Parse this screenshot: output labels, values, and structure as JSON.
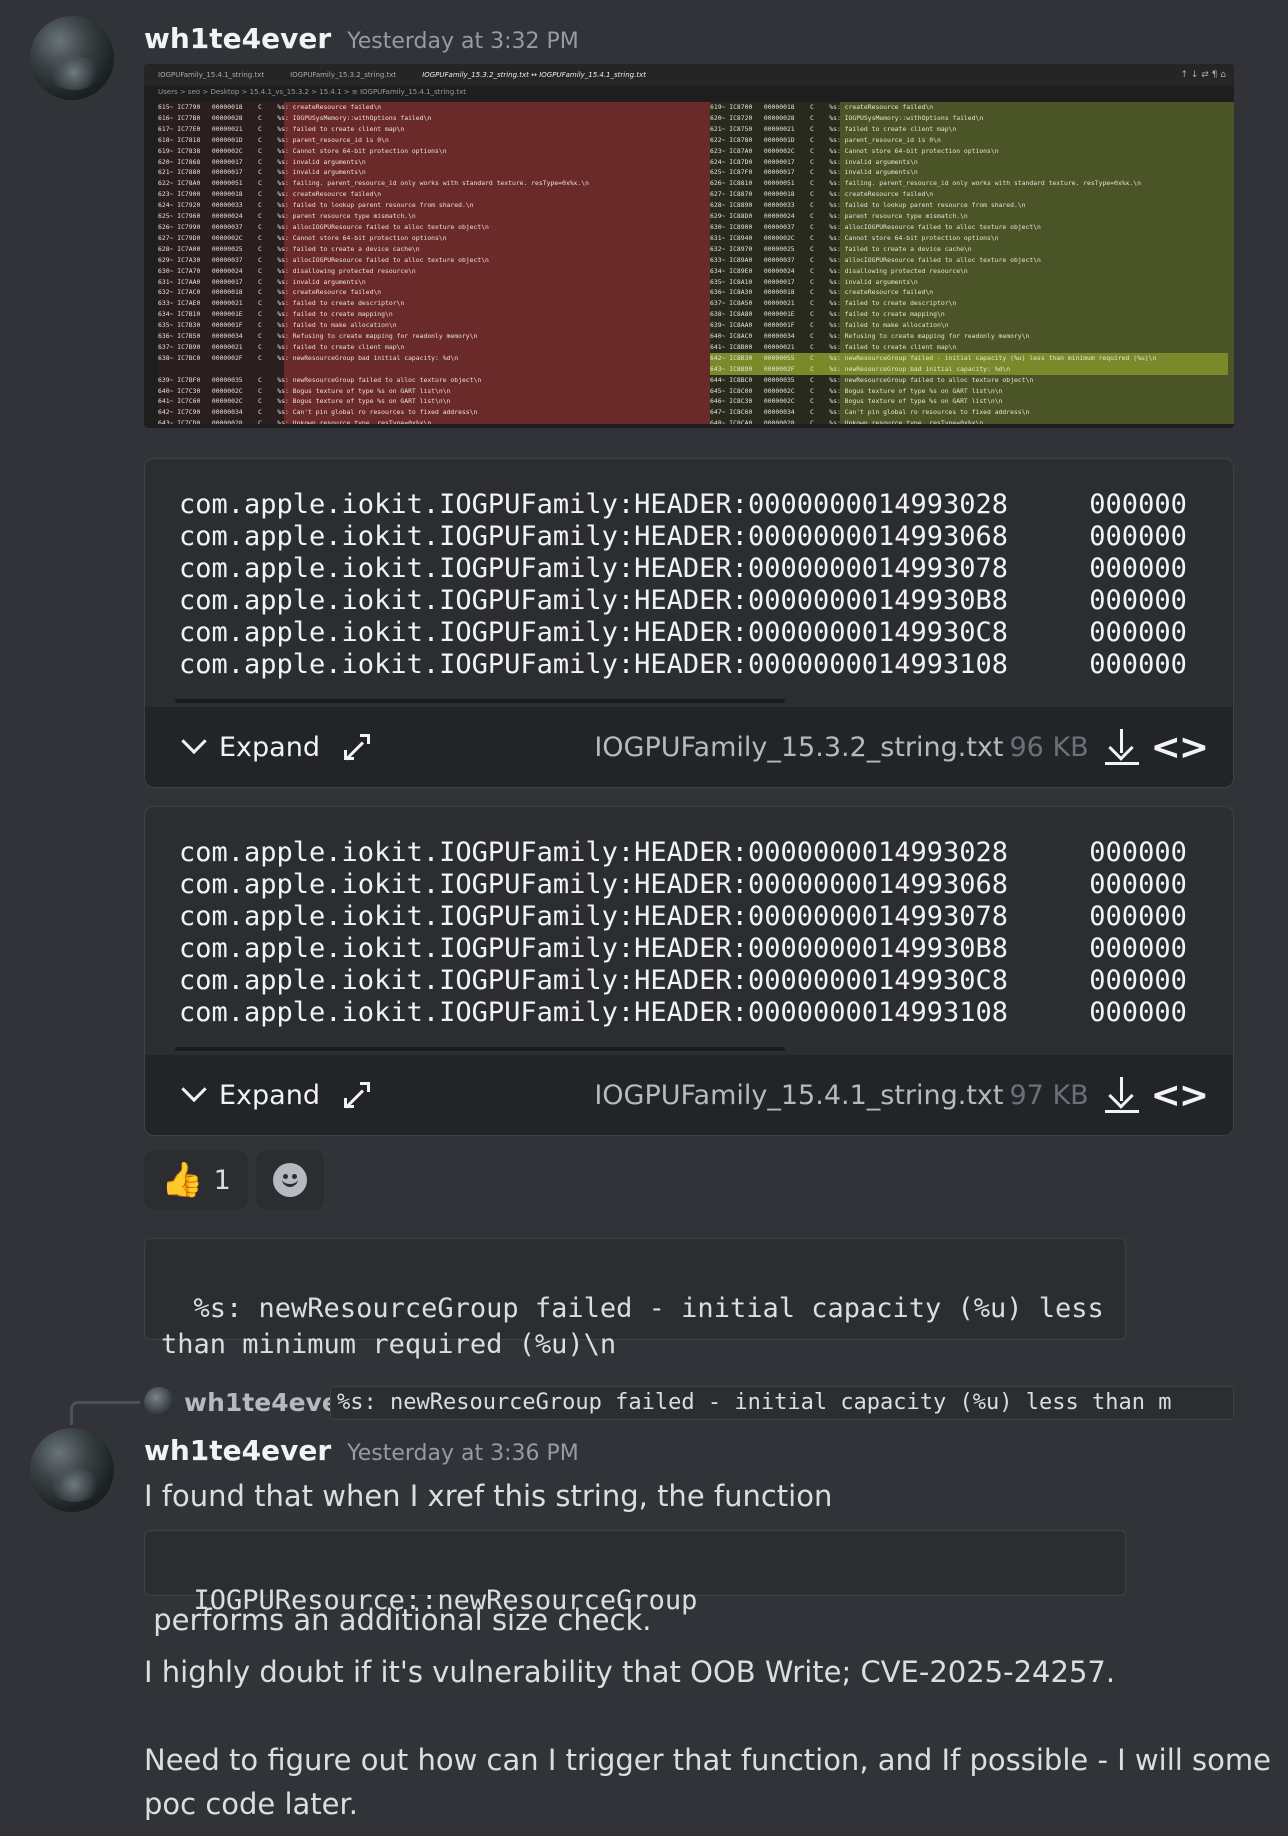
{
  "message1": {
    "username": "wh1te4ever",
    "timestamp": "Yesterday at 3:32 PM"
  },
  "screenshot": {
    "tabs": [
      "IOGPUFamily_15.4.1_string.txt",
      "IOGPUFamily_15.3.2_string.txt",
      "IOGPUFamily_15.3.2_string.txt ↔ IOGPUFamily_15.4.1_string.txt"
    ],
    "controls": "↑ ↓ ⇄ ¶ ⌂",
    "breadcrumb": "Users > seo > Desktop > 15.4.1_vs_15.3.2 > 15.4.1 > ≡ IOGPUFamily_15.4.1_string.txt",
    "left_lines": [
      "615~ IC7790   00000018    C    %s: createResource failed\\n",
      "616~ IC77B0   00000028    C    %s: IOGPUSysMemory::withOptions failed\\n",
      "617~ IC77E0   00000021    C    %s: failed to create client map\\n",
      "618~ IC7818   0000001D    C    %s: parent_resource_id is 0\\n",
      "619~ IC7838   0000002C    C    %s: Cannot store 64-bit protection options\\n",
      "620~ IC7868   00000017    C    %s: invalid arguments\\n",
      "621~ IC7880   00000017    C    %s: invalid arguments\\n",
      "622~ IC78A0   00000051    C    %s: failing. parent_resource_id only works with standard texture. resType=0x%x.\\n",
      "623~ IC7900   00000018    C    %s: createResource failed\\n",
      "624~ IC7920   00000033    C    %s: failed to lookup parent resource from shared.\\n",
      "625~ IC7960   00000024    C    %s: parent resource type mismatch.\\n",
      "626~ IC7990   00000037    C    %s: allocIOGPUResource failed to alloc texture object\\n",
      "627~ IC79D0   0000002C    C    %s: Cannot store 64-bit protection options\\n",
      "628~ IC7A00   00000025    C    %s: failed to create a device cache\\n",
      "629~ IC7A30   00000037    C    %s: allocIOGPUResource failed to alloc texture object\\n",
      "630~ IC7A70   00000024    C    %s: disallowing protected resource\\n",
      "631~ IC7AA0   00000017    C    %s: invalid arguments\\n",
      "632~ IC7AC0   00000018    C    %s: createResource failed\\n",
      "633~ IC7AE0   00000021    C    %s: failed to create descriptor\\n",
      "634~ IC7B10   0000001E    C    %s: failed to create mapping\\n",
      "635~ IC7B30   0000001F    C    %s: failed to make allocation\\n",
      "636~ IC7B50   00000034    C    %s: Refusing to create mapping for readonly memory\\n",
      "637~ IC7B90   00000021    C    %s: failed to create client map\\n",
      "638~ IC7BC0   0000002F    C    %s: newResourceGroup bad initial capacity: %d\\n",
      "",
      "639~ IC7BF0   00000035    C    %s: newResourceGroup failed to alloc texture object\\n",
      "640~ IC7C30   0000002C    C    %s: Bogus texture of type %s on GART list\\n\\n",
      "641~ IC7C60   0000002C    C    %s: Bogus texture of type %s on GART list\\n\\n",
      "642~ IC7C90   00000034    C    %s: Can't pin global ro resources to fixed address\\n",
      "643~ IC7CD0   00000028    C    %s: Unkown resource type. resType=0x%x\\n"
    ],
    "right_lines": [
      "619~ IC8700   00000018    C    %s: createResource failed\\n",
      "620~ IC8720   00000028    C    %s: IOGPUSysMemory::withOptions failed\\n",
      "621~ IC8750   00000021    C    %s: failed to create client map\\n",
      "622~ IC8780   0000001D    C    %s: parent_resource_id is 0\\n",
      "623~ IC87A0   0000002C    C    %s: Cannot store 64-bit protection options\\n",
      "624~ IC87D0   00000017    C    %s: invalid arguments\\n",
      "625~ IC87F0   00000017    C    %s: invalid arguments\\n",
      "626~ IC8810   00000051    C    %s: failing. parent_resource_id only works with standard texture. resType=0x%x.\\n",
      "627~ IC8870   00000018    C    %s: createResource failed\\n",
      "628~ IC8890   00000033    C    %s: failed to lookup parent resource from shared.\\n",
      "629~ IC88D0   00000024    C    %s: parent resource type mismatch.\\n",
      "630~ IC8900   00000037    C    %s: allocIOGPUResource failed to alloc texture object\\n",
      "631~ IC8940   0000002C    C    %s: Cannot store 64-bit protection options\\n",
      "632~ IC8970   00000025    C    %s: failed to create a device cache\\n",
      "633~ IC89A0   00000037    C    %s: allocIOGPUResource failed to alloc texture object\\n",
      "634~ IC89E0   00000024    C    %s: disallowing protected resource\\n",
      "635~ IC8A10   00000017    C    %s: invalid arguments\\n",
      "636~ IC8A30   00000018    C    %s: createResource failed\\n",
      "637~ IC8A50   00000021    C    %s: failed to create descriptor\\n",
      "638~ IC8A80   0000001E    C    %s: failed to create mapping\\n",
      "639~ IC8AA0   0000001F    C    %s: failed to make allocation\\n",
      "640~ IC8AC0   00000034    C    %s: Refusing to create mapping for readonly memory\\n",
      "641~ IC8B00   00000021    C    %s: failed to create client map\\n",
      "642~ IC8B30   00000055    C    %s: newResourceGroup failed - initial capacity (%u) less than minimum required (%u)\\n",
      "643~ IC8B90   0000002F    C    %s: newResourceGroup bad initial capacity: %d\\n",
      "644~ IC8BC0   00000035    C    %s: newResourceGroup failed to alloc texture object\\n",
      "645~ IC8C00   0000002C    C    %s: Bogus texture of type %s on GART list\\n\\n",
      "646~ IC8C30   0000002C    C    %s: Bogus texture of type %s on GART list\\n\\n",
      "647~ IC8C60   00000034    C    %s: Can't pin global ro resources to fixed address\\n",
      "648~ IC8CA0   00000028    C    %s: Unkown resource type. resType=0x%x\\n"
    ]
  },
  "file1": {
    "content": "com.apple.iokit.IOGPUFamily:HEADER:0000000014993028     000000\ncom.apple.iokit.IOGPUFamily:HEADER:0000000014993068     000000\ncom.apple.iokit.IOGPUFamily:HEADER:0000000014993078     000000\ncom.apple.iokit.IOGPUFamily:HEADER:00000000149930B8     000000\ncom.apple.iokit.IOGPUFamily:HEADER:00000000149930C8     000000\ncom.apple.iokit.IOGPUFamily:HEADER:0000000014993108     000000",
    "expand_label": "Expand",
    "name": "IOGPUFamily_15.3.2_string.txt",
    "size": "96 KB"
  },
  "file2": {
    "content": "com.apple.iokit.IOGPUFamily:HEADER:0000000014993028     000000\ncom.apple.iokit.IOGPUFamily:HEADER:0000000014993068     000000\ncom.apple.iokit.IOGPUFamily:HEADER:0000000014993078     000000\ncom.apple.iokit.IOGPUFamily:HEADER:00000000149930B8     000000\ncom.apple.iokit.IOGPUFamily:HEADER:00000000149930C8     000000\ncom.apple.iokit.IOGPUFamily:HEADER:0000000014993108     000000",
    "expand_label": "Expand",
    "name": "IOGPUFamily_15.4.1_string.txt",
    "size": "97 KB"
  },
  "reactions": {
    "thumbs_up_emoji": "👍",
    "thumbs_up_count": "1"
  },
  "code_block1": "%s: newResourceGroup failed - initial capacity (%u) less\nthan minimum required (%u)\\n",
  "reply": {
    "username": "wh1te4ever",
    "snippet": "%s: newResourceGroup failed - initial capacity (%u) less than m"
  },
  "message2": {
    "username": "wh1te4ever",
    "timestamp": "Yesterday at 3:36 PM",
    "line1": "I found that when I xref this string, the function",
    "inline_code": "IOGPUResource::newResourceGroup",
    "line2": " performs an additional size check.",
    "line3": "I highly doubt if it's vulnerability that OOB Write; CVE-2025-24257.",
    "line4": "Need to figure out how can I trigger that function, and If possible - I will some",
    "line5": "poc code later."
  }
}
